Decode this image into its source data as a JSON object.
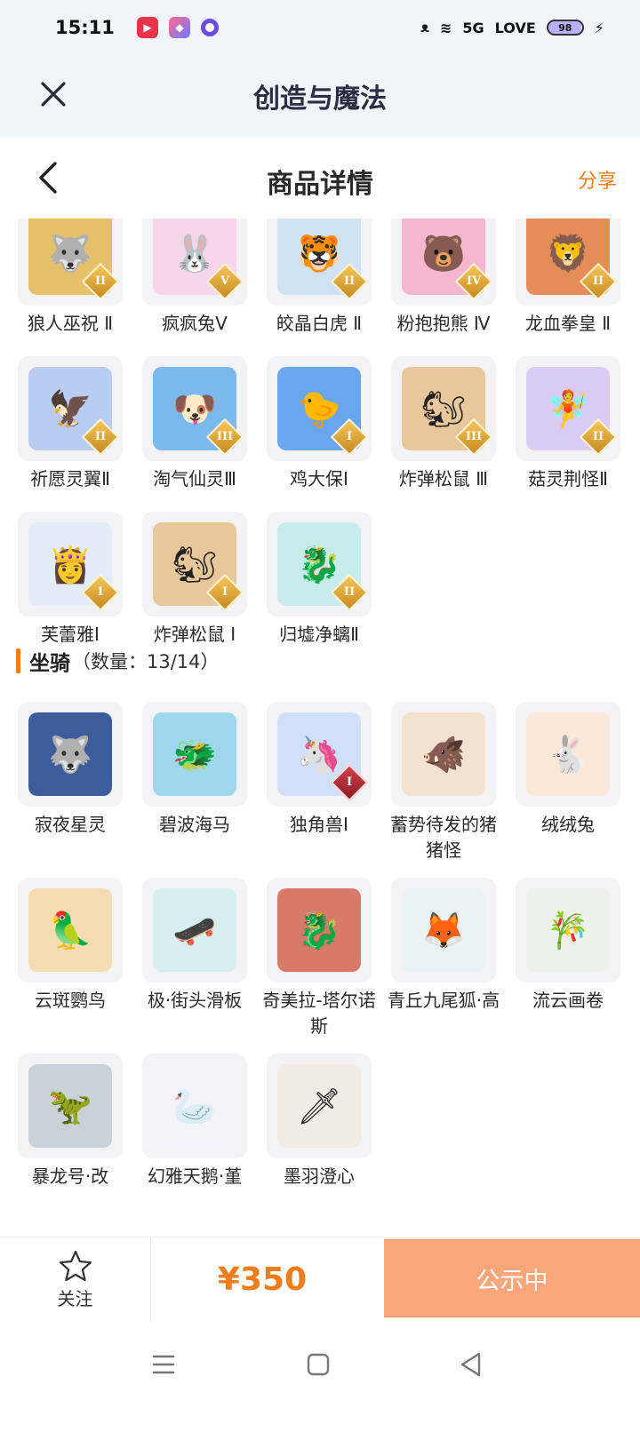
{
  "status_bar": {
    "time": "15:11",
    "network": "5G",
    "love": "LOVE",
    "battery": "98"
  },
  "title_bar": {
    "title": "创造与魔法"
  },
  "detail_header": {
    "title": "商品详情",
    "share": "分享"
  },
  "pets": [
    {
      "name": "狼人巫祝 Ⅱ",
      "tier": "II",
      "emoji": "🐺",
      "bg": "#e7c06a"
    },
    {
      "name": "疯疯兔Ⅴ",
      "tier": "V",
      "emoji": "🐰",
      "bg": "#f6d6ea"
    },
    {
      "name": "皎晶白虎 Ⅱ",
      "tier": "II",
      "emoji": "🐯",
      "bg": "#cfe3f5"
    },
    {
      "name": "粉抱抱熊 Ⅳ",
      "tier": "IV",
      "emoji": "🐻",
      "bg": "#f7b6cf"
    },
    {
      "name": "龙血拳皇 Ⅱ",
      "tier": "II",
      "emoji": "🦁",
      "bg": "#e58d58"
    },
    {
      "name": "祈愿灵翼Ⅱ",
      "tier": "II",
      "emoji": "🦅",
      "bg": "#b9cdf2"
    },
    {
      "name": "淘气仙灵Ⅲ",
      "tier": "III",
      "emoji": "🐶",
      "bg": "#7ab8ee"
    },
    {
      "name": "鸡大保Ⅰ",
      "tier": "I",
      "emoji": "🐤",
      "bg": "#6aa6ef"
    },
    {
      "name": "炸弹松鼠 Ⅲ",
      "tier": "III",
      "emoji": "🐿",
      "bg": "#e8c79a"
    },
    {
      "name": "菇灵荆怪Ⅱ",
      "tier": "II",
      "emoji": "🧚",
      "bg": "#d9cbf3"
    },
    {
      "name": "芙蕾雅Ⅰ",
      "tier": "I",
      "emoji": "👸",
      "bg": "#e4ecfa"
    },
    {
      "name": "炸弹松鼠 Ⅰ",
      "tier": "I",
      "emoji": "🐿",
      "bg": "#e8c79a"
    },
    {
      "name": "归墟净螭Ⅱ",
      "tier": "II",
      "emoji": "🐉",
      "bg": "#c8ecec"
    }
  ],
  "mounts_section": {
    "label": "坐骑",
    "count": "（数量：13/14）"
  },
  "mounts": [
    {
      "name": "寂夜星灵",
      "tier": "",
      "emoji": "🐺",
      "bg": "#3d5c9c"
    },
    {
      "name": "碧波海马",
      "tier": "",
      "emoji": "🐲",
      "bg": "#9ed7ee"
    },
    {
      "name": "独角兽Ⅰ",
      "tier": "I",
      "emoji": "🦄",
      "bg": "#cfe0f7"
    },
    {
      "name": "蓄势待发的猪猪怪",
      "tier": "",
      "emoji": "🐗",
      "bg": "#f3e2cf"
    },
    {
      "name": "绒绒兔",
      "tier": "",
      "emoji": "🐇",
      "bg": "#fbe8d9"
    },
    {
      "name": "云斑鹦鸟",
      "tier": "",
      "emoji": "🦜",
      "bg": "#f6dcb3"
    },
    {
      "name": "极·街头滑板",
      "tier": "",
      "emoji": "🛹",
      "bg": "#d8eef0"
    },
    {
      "name": "奇美拉-塔尔诺斯",
      "tier": "",
      "emoji": "🐉",
      "bg": "#d77a6a"
    },
    {
      "name": "青丘九尾狐·高",
      "tier": "",
      "emoji": "🦊",
      "bg": "#e8f2f7"
    },
    {
      "name": "流云画卷",
      "tier": "",
      "emoji": "🎋",
      "bg": "#eef0ea"
    },
    {
      "name": "暴龙号·改",
      "tier": "",
      "emoji": "🦖",
      "bg": "#c8d2d8"
    },
    {
      "name": "幻雅天鹅·堇",
      "tier": "",
      "emoji": "🦢",
      "bg": "#f3f1fa"
    },
    {
      "name": "墨羽澄心",
      "tier": "",
      "emoji": "🗡",
      "bg": "#f0ece4"
    }
  ],
  "action_bar": {
    "follow": "关注",
    "price": "¥350",
    "status": "公示中"
  },
  "nav": {
    "menu": "menu-icon",
    "home": "home-icon",
    "back": "back-icon"
  }
}
